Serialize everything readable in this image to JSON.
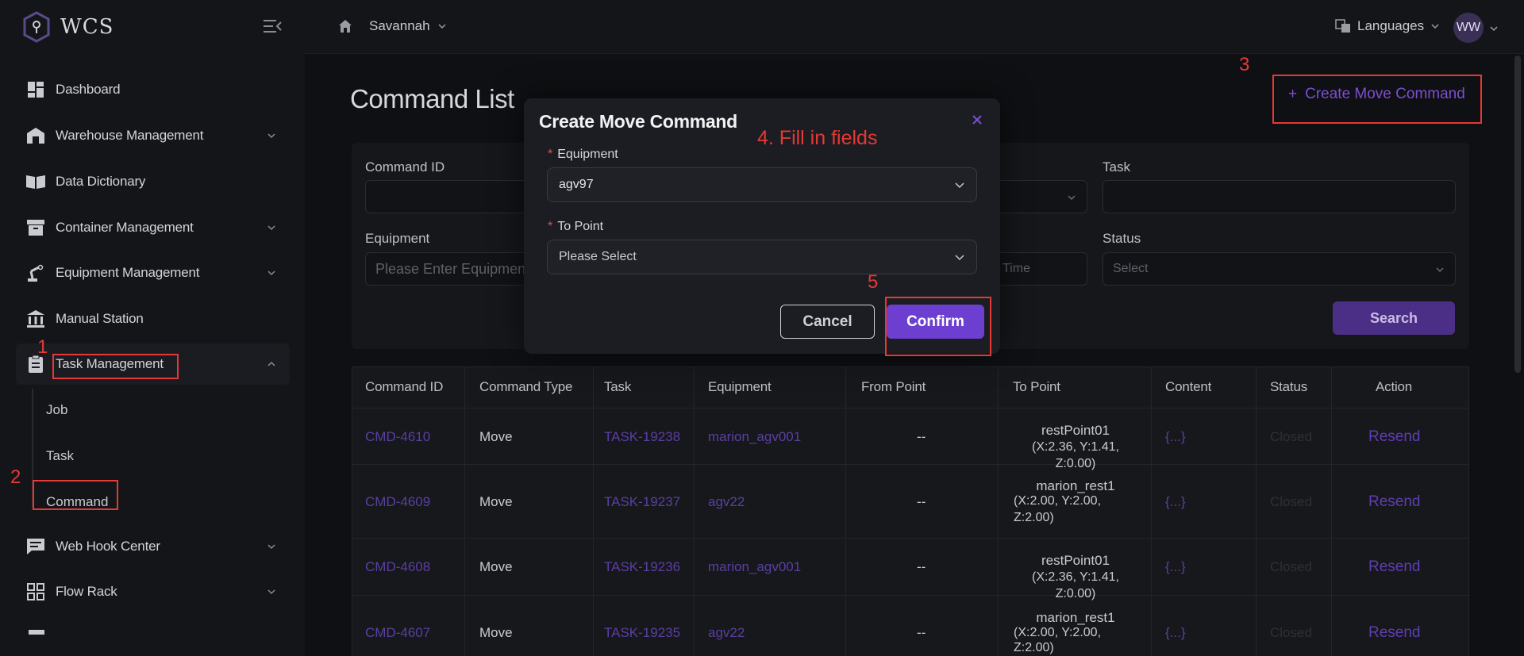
{
  "app": {
    "name": "WCS"
  },
  "header": {
    "warehouse": "Savannah",
    "languages_label": "Languages",
    "avatar_initials": "WW"
  },
  "sidebar": {
    "items": [
      {
        "label": "Dashboard",
        "icon": "dashboard-icon"
      },
      {
        "label": "Warehouse Management",
        "icon": "warehouse-icon"
      },
      {
        "label": "Data Dictionary",
        "icon": "book-icon"
      },
      {
        "label": "Container Management",
        "icon": "archive-icon"
      },
      {
        "label": "Equipment Management",
        "icon": "robot-arm-icon"
      },
      {
        "label": "Manual Station",
        "icon": "station-icon"
      },
      {
        "label": "Task Management",
        "icon": "clipboard-icon"
      },
      {
        "label": "Web Hook Center",
        "icon": "message-icon"
      },
      {
        "label": "Flow Rack",
        "icon": "grid-icon"
      }
    ],
    "task_sub": [
      "Job",
      "Task",
      "Command"
    ]
  },
  "main": {
    "title": "Command List",
    "create_button": "Create Move Command",
    "create_plus": "+",
    "filters": {
      "command_id_label": "Command ID",
      "task_label": "Task",
      "equipment_label": "Equipment",
      "equipment_placeholder": "Please Enter Equipment",
      "status_label": "Status",
      "status_placeholder": "Select",
      "time_placeholder": "Time",
      "search_button": "Search"
    },
    "table": {
      "headers": [
        "Command ID",
        "Command Type",
        "Task",
        "Equipment",
        "From Point",
        "To Point",
        "Content",
        "Status",
        "Action"
      ],
      "rows": [
        {
          "id": "CMD-4610",
          "type": "Move",
          "task": "TASK-19238",
          "equipment": "marion_agv001",
          "from": "--",
          "to_name": "restPoint01",
          "to_coords": "(X:2.36, Y:1.41, Z:0.00)",
          "content": "{...}",
          "status": "Closed",
          "action": "Resend"
        },
        {
          "id": "CMD-4609",
          "type": "Move",
          "task": "TASK-19237",
          "equipment": "agv22",
          "from": "--",
          "to_name": "marion_rest1",
          "to_coords": "(X:2.00, Y:2.00,",
          "to_coords2": "Z:2.00)",
          "content": "{...}",
          "status": "Closed",
          "action": "Resend"
        },
        {
          "id": "CMD-4608",
          "type": "Move",
          "task": "TASK-19236",
          "equipment": "marion_agv001",
          "from": "--",
          "to_name": "restPoint01",
          "to_coords": "(X:2.36, Y:1.41, Z:0.00)",
          "content": "{...}",
          "status": "Closed",
          "action": "Resend"
        },
        {
          "id": "CMD-4607",
          "type": "Move",
          "task": "TASK-19235",
          "equipment": "agv22",
          "from": "--",
          "to_name": "marion_rest1",
          "to_coords": "(X:2.00, Y:2.00,",
          "to_coords2": "Z:2.00)",
          "content": "{...}",
          "status": "Closed",
          "action": "Resend"
        }
      ]
    }
  },
  "dialog": {
    "title": "Create Move Command",
    "equipment_label": "Equipment",
    "equipment_value": "agv97",
    "to_point_label": "To Point",
    "to_point_placeholder": "Please Select",
    "required_mark": "*",
    "cancel": "Cancel",
    "confirm": "Confirm"
  },
  "annotations": {
    "n1": "1",
    "n2": "2",
    "n3": "3",
    "n5": "5",
    "step4": "4. Fill in fields"
  },
  "colors": {
    "accent": "#6c3fd1",
    "annotation": "#e53935",
    "background": "#0f1013"
  }
}
